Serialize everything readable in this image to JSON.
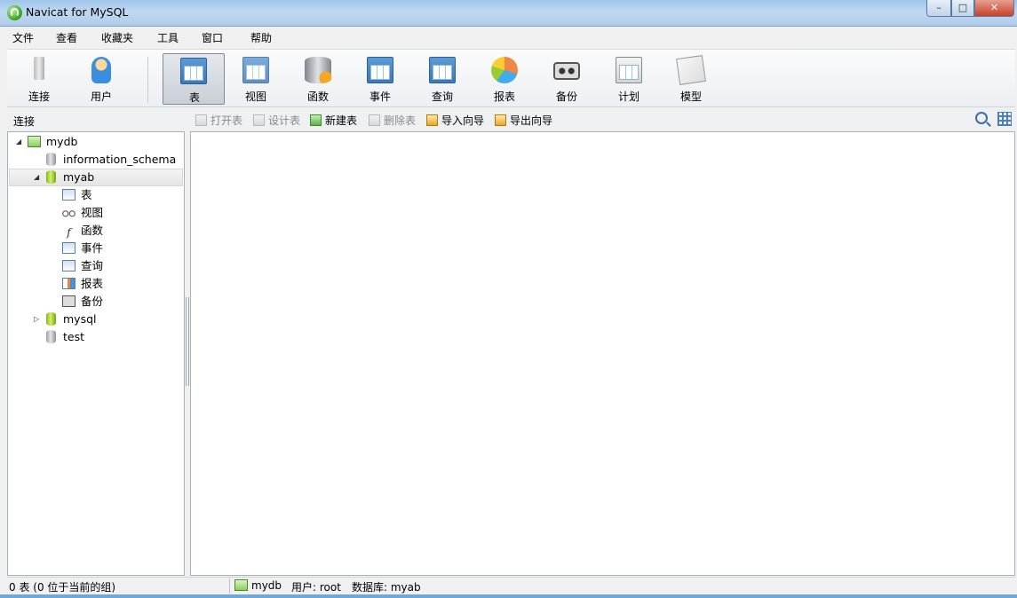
{
  "window": {
    "title": "Navicat for MySQL",
    "min": "–",
    "max": "□",
    "close": "✕"
  },
  "menu": [
    "文件",
    "查看",
    "收藏夹",
    "工具",
    "窗口",
    "帮助"
  ],
  "toolbar": [
    {
      "label": "连接",
      "icon": "connect-icon"
    },
    {
      "label": "用户",
      "icon": "user-icon"
    },
    {
      "label": "表",
      "icon": "table-icon",
      "active": true
    },
    {
      "label": "视图",
      "icon": "view-icon"
    },
    {
      "label": "函数",
      "icon": "function-icon"
    },
    {
      "label": "事件",
      "icon": "event-icon"
    },
    {
      "label": "查询",
      "icon": "query-icon"
    },
    {
      "label": "报表",
      "icon": "report-icon"
    },
    {
      "label": "备份",
      "icon": "backup-icon"
    },
    {
      "label": "计划",
      "icon": "schedule-icon"
    },
    {
      "label": "模型",
      "icon": "model-icon"
    }
  ],
  "subbar": {
    "section_label": "连接",
    "actions": [
      {
        "label": "打开表",
        "enabled": false
      },
      {
        "label": "设计表",
        "enabled": false
      },
      {
        "label": "新建表",
        "enabled": true
      },
      {
        "label": "删除表",
        "enabled": false
      },
      {
        "label": "导入向导",
        "enabled": true
      },
      {
        "label": "导出向导",
        "enabled": true
      }
    ]
  },
  "tree": {
    "connection": "mydb",
    "databases": [
      {
        "name": "information_schema",
        "open": false
      },
      {
        "name": "myab",
        "open": true,
        "children": [
          "表",
          "视图",
          "函数",
          "事件",
          "查询",
          "报表",
          "备份"
        ]
      },
      {
        "name": "mysql",
        "open": false
      },
      {
        "name": "test",
        "open": false
      }
    ]
  },
  "status": {
    "left": "0 表 (0 位于当前的组)",
    "connection": "mydb",
    "user": "用户: root",
    "database": "数据库: myab"
  },
  "colors": {
    "accent": "#3a78b8",
    "db_open": "#8cc63f"
  }
}
